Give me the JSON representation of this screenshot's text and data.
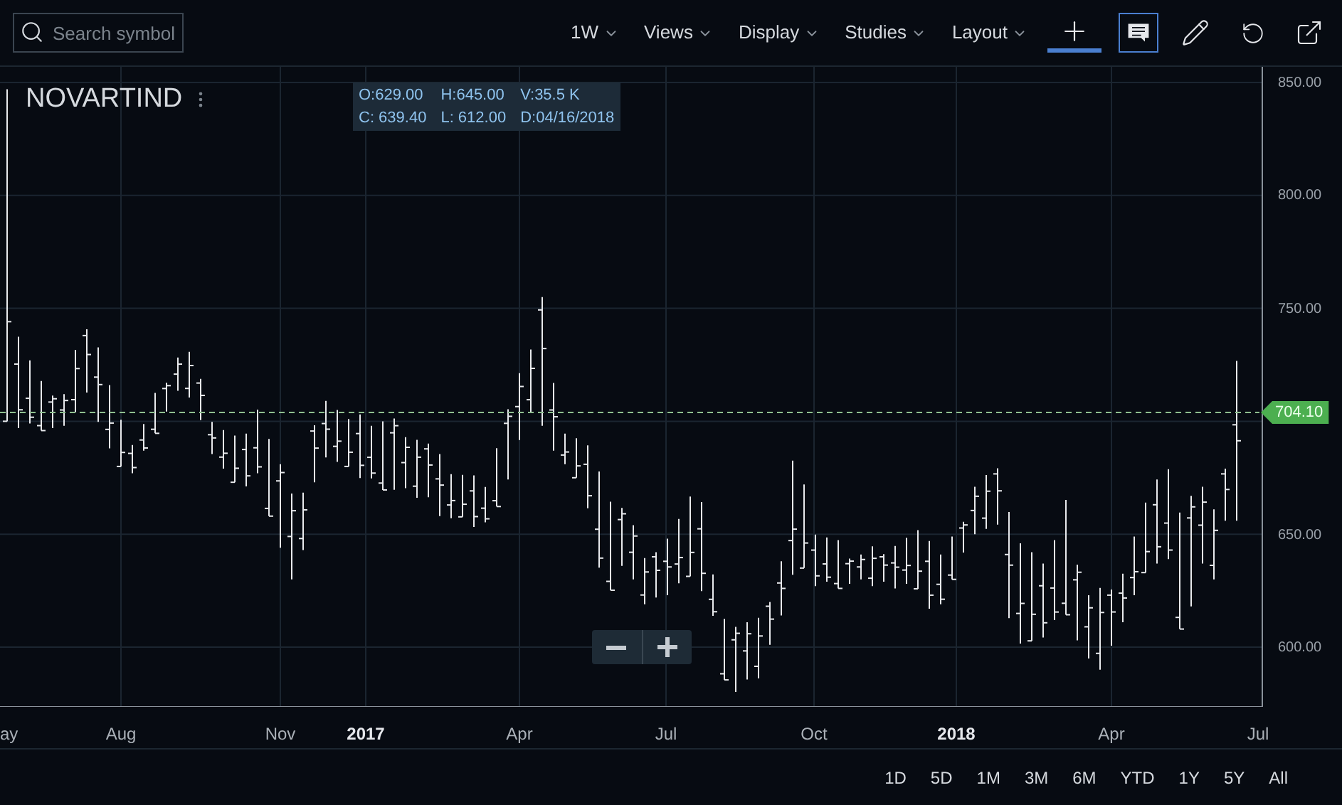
{
  "toolbar": {
    "search": {
      "placeholder": "Search symbol"
    },
    "menus": [
      {
        "label": "1W"
      },
      {
        "label": "Views"
      },
      {
        "label": "Display"
      },
      {
        "label": "Studies"
      },
      {
        "label": "Layout"
      }
    ],
    "tools": [
      {
        "kind": "crosshair",
        "selected": true
      },
      {
        "kind": "comment",
        "selected": true
      },
      {
        "kind": "draw",
        "selected": false
      },
      {
        "kind": "undo",
        "selected": false
      },
      {
        "kind": "popout",
        "selected": false
      }
    ]
  },
  "chart": {
    "symbol": "NOVARTIND",
    "legend": [
      "O:629.00",
      "H:645.00",
      "V:35.5 K",
      "C: 639.40",
      "L: 612.00",
      "D:04/16/2018"
    ],
    "y_axis": [
      "850.00",
      "800.00",
      "750.00",
      "650.00",
      "600.00"
    ],
    "last_price": "704.10",
    "x_axis": [
      {
        "label": "ay",
        "bold": false
      },
      {
        "label": "Aug",
        "bold": false
      },
      {
        "label": "Nov",
        "bold": false
      },
      {
        "label": "2017",
        "bold": true
      },
      {
        "label": "Apr",
        "bold": false
      },
      {
        "label": "Jul",
        "bold": false
      },
      {
        "label": "Oct",
        "bold": false
      },
      {
        "label": "2018",
        "bold": true
      },
      {
        "label": "Apr",
        "bold": false
      },
      {
        "label": "Jul",
        "bold": false
      }
    ]
  },
  "ranges": [
    {
      "label": "1D"
    },
    {
      "label": "5D"
    },
    {
      "label": "1M"
    },
    {
      "label": "3M"
    },
    {
      "label": "6M"
    },
    {
      "label": "YTD"
    },
    {
      "label": "1Y"
    },
    {
      "label": "5Y"
    },
    {
      "label": "All"
    }
  ]
}
